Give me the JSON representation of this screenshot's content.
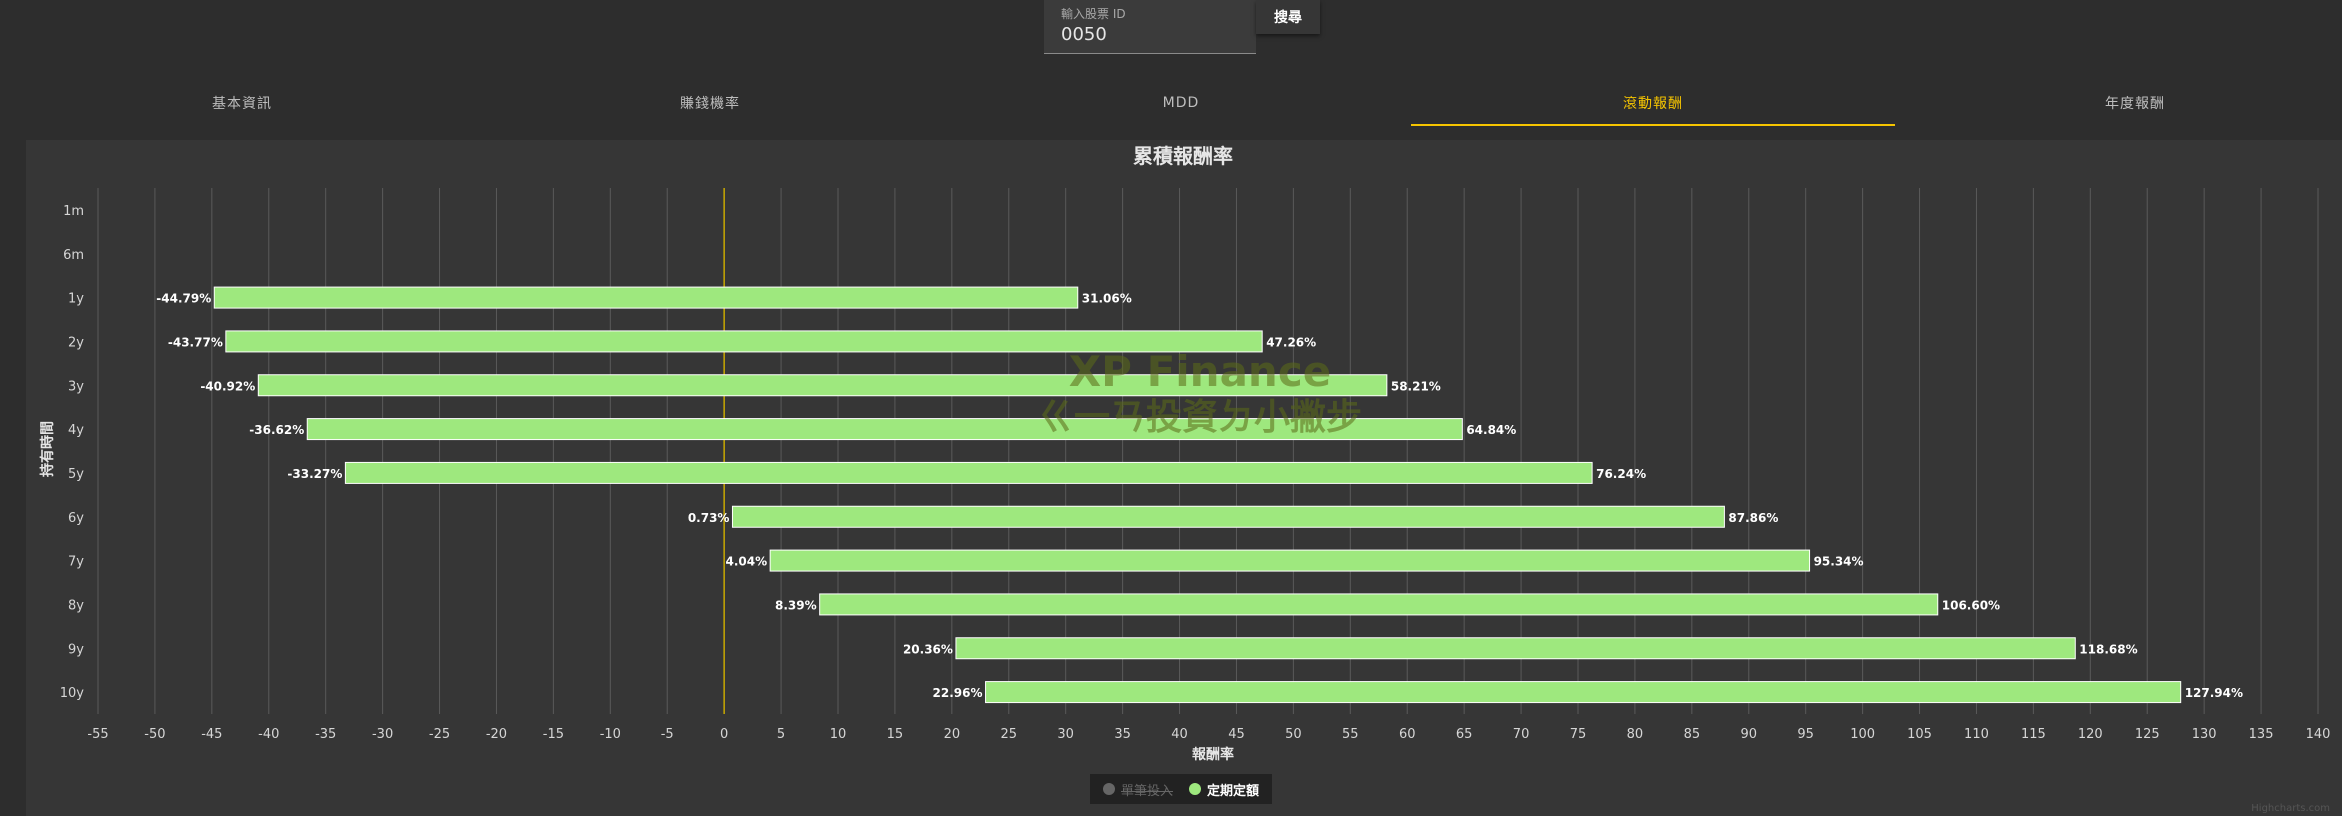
{
  "search": {
    "label": "輸入股票 ID",
    "value": "0050",
    "button_label": "搜尋"
  },
  "tabs": [
    {
      "label": "基本資訊",
      "active": false
    },
    {
      "label": "賺錢機率",
      "active": false
    },
    {
      "label": "MDD",
      "active": false
    },
    {
      "label": "滾動報酬",
      "active": true
    },
    {
      "label": "年度報酬",
      "active": false
    }
  ],
  "colors": {
    "accent": "#f5c400",
    "bar": "#9ee87e",
    "zero_line": "#c8a800"
  },
  "watermark": {
    "line1": "XP Finance",
    "line2": "ㄍ一ㄢ投資ㄉ小撇步"
  },
  "credit": "Highcharts.com",
  "legend": [
    {
      "label": "單筆投入",
      "visible": false,
      "color": "#666666"
    },
    {
      "label": "定期定額",
      "visible": true,
      "color": "#9ee87e"
    }
  ],
  "chart_data": {
    "type": "bar",
    "title": "累積報酬率",
    "xlabel": "報酬率",
    "ylabel": "持有時間",
    "xlim": [
      -55,
      140
    ],
    "xticks": [
      -55,
      -50,
      -45,
      -40,
      -35,
      -30,
      -25,
      -20,
      -15,
      -10,
      -5,
      0,
      5,
      10,
      15,
      20,
      25,
      30,
      35,
      40,
      45,
      50,
      55,
      60,
      65,
      70,
      75,
      80,
      85,
      90,
      95,
      100,
      105,
      110,
      115,
      120,
      125,
      130,
      135,
      140
    ],
    "categories": [
      "1m",
      "6m",
      "1y",
      "2y",
      "3y",
      "4y",
      "5y",
      "6y",
      "7y",
      "8y",
      "9y",
      "10y"
    ],
    "grid": true,
    "series": [
      {
        "name": "定期定額",
        "type": "columnrange",
        "low": [
          null,
          null,
          -44.79,
          -43.77,
          -40.92,
          -36.62,
          -33.27,
          0.73,
          4.04,
          8.39,
          20.36,
          22.96
        ],
        "high": [
          null,
          null,
          31.06,
          47.26,
          58.21,
          64.84,
          76.24,
          87.86,
          95.34,
          106.6,
          118.68,
          127.94
        ],
        "low_labels": [
          "",
          "",
          "-44.79%",
          "-43.77%",
          "-40.92%",
          "-36.62%",
          "-33.27%",
          "0.73%",
          "4.04%",
          "8.39%",
          "20.36%",
          "22.96%"
        ],
        "high_labels": [
          "",
          "",
          "31.06%",
          "47.26%",
          "58.21%",
          "64.84%",
          "76.24%",
          "87.86%",
          "95.34%",
          "106.60%",
          "118.68%",
          "127.94%"
        ]
      }
    ],
    "legend_position": "bottom-center"
  }
}
